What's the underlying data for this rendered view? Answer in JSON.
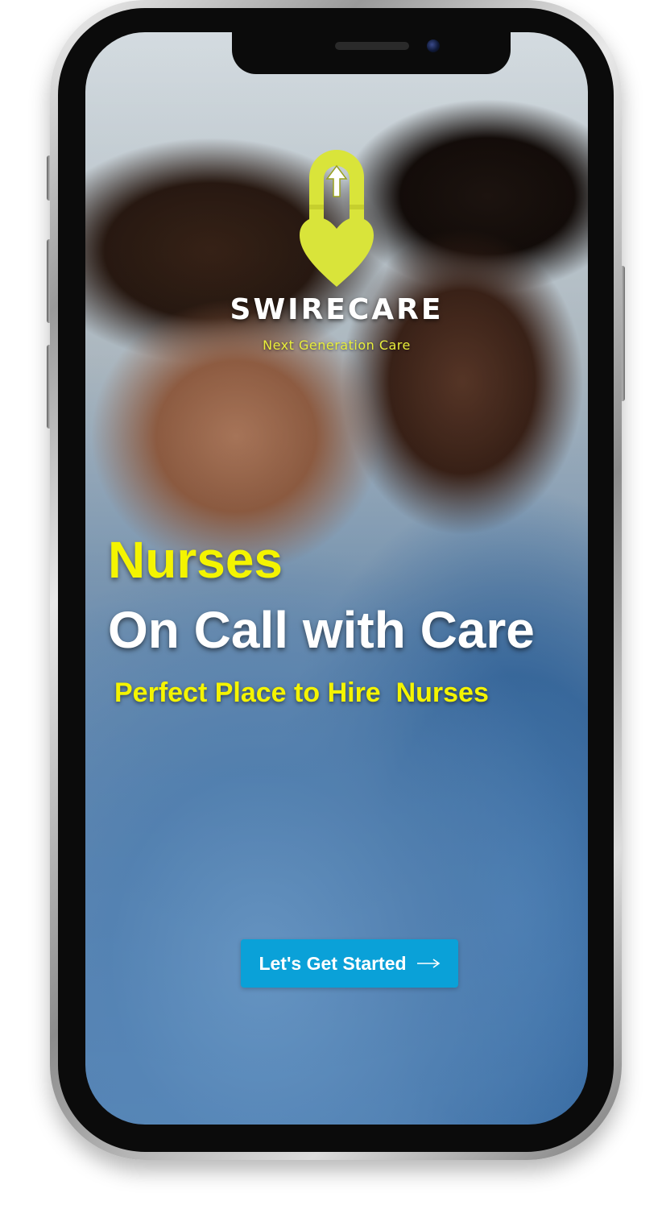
{
  "brand": {
    "name": "SWIRECARE",
    "tagline": "Next Generation Care",
    "logo_icon": "footprint-heart-arrow-icon",
    "logo_color": "#d9e43a"
  },
  "hero": {
    "title": "Nurses",
    "subtitle": "On Call with Care",
    "tagline": "Perfect Place to Hire  Nurses"
  },
  "cta": {
    "label": "Let's Get Started",
    "icon": "arrow-right-icon",
    "color": "#0aa1d8"
  },
  "colors": {
    "accent_yellow": "#f4f400",
    "text_white": "#ffffff"
  }
}
